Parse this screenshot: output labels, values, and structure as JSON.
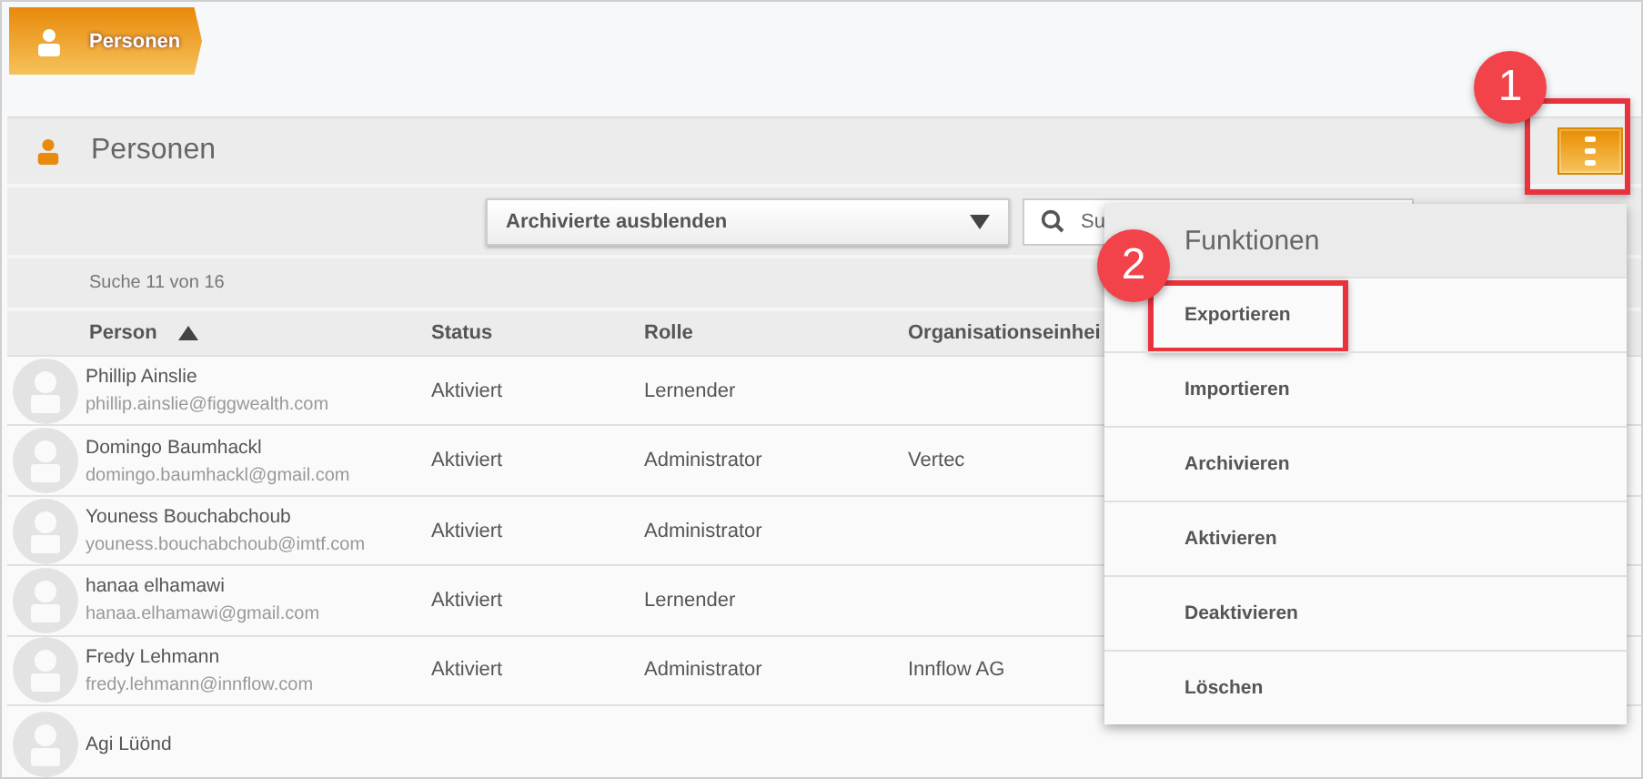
{
  "breadcrumb": {
    "label": "Personen"
  },
  "panel": {
    "title": "Personen"
  },
  "toolbar": {
    "filter": {
      "value": "Archivierte ausblenden"
    },
    "search": {
      "placeholder": "Su"
    }
  },
  "result_count": "Suche 11 von 16",
  "table": {
    "columns": [
      {
        "label": "Person",
        "sorted": true
      },
      {
        "label": "Status",
        "sorted": false
      },
      {
        "label": "Rolle",
        "sorted": false
      },
      {
        "label": "Organisationseinhei",
        "sorted": false
      }
    ],
    "rows": [
      {
        "name": "Phillip Ainslie",
        "email": "phillip.ainslie@figgwealth.com",
        "status": "Aktiviert",
        "role": "Lernender",
        "org": ""
      },
      {
        "name": "Domingo Baumhackl",
        "email": "domingo.baumhackl@gmail.com",
        "status": "Aktiviert",
        "role": "Administrator",
        "org": "Vertec"
      },
      {
        "name": "Youness Bouchabchoub",
        "email": "youness.bouchabchoub@imtf.com",
        "status": "Aktiviert",
        "role": "Administrator",
        "org": ""
      },
      {
        "name": "hanaa elhamawi",
        "email": "hanaa.elhamawi@gmail.com",
        "status": "Aktiviert",
        "role": "Lernender",
        "org": ""
      },
      {
        "name": "Fredy Lehmann",
        "email": "fredy.lehmann@innflow.com",
        "status": "Aktiviert",
        "role": "Administrator",
        "org": "Innflow AG"
      },
      {
        "name": "Agi Lüönd",
        "email": "",
        "status": "",
        "role": "",
        "org": ""
      }
    ]
  },
  "menu": {
    "open": true,
    "title": "Funktionen",
    "items": [
      {
        "label": "Exportieren",
        "highlighted": true
      },
      {
        "label": "Importieren",
        "highlighted": false
      },
      {
        "label": "Archivieren",
        "highlighted": false
      },
      {
        "label": "Aktivieren",
        "highlighted": false
      },
      {
        "label": "Deaktivieren",
        "highlighted": false
      },
      {
        "label": "Löschen",
        "highlighted": false
      }
    ]
  },
  "callouts": [
    {
      "label": "1"
    },
    {
      "label": "2"
    }
  ]
}
